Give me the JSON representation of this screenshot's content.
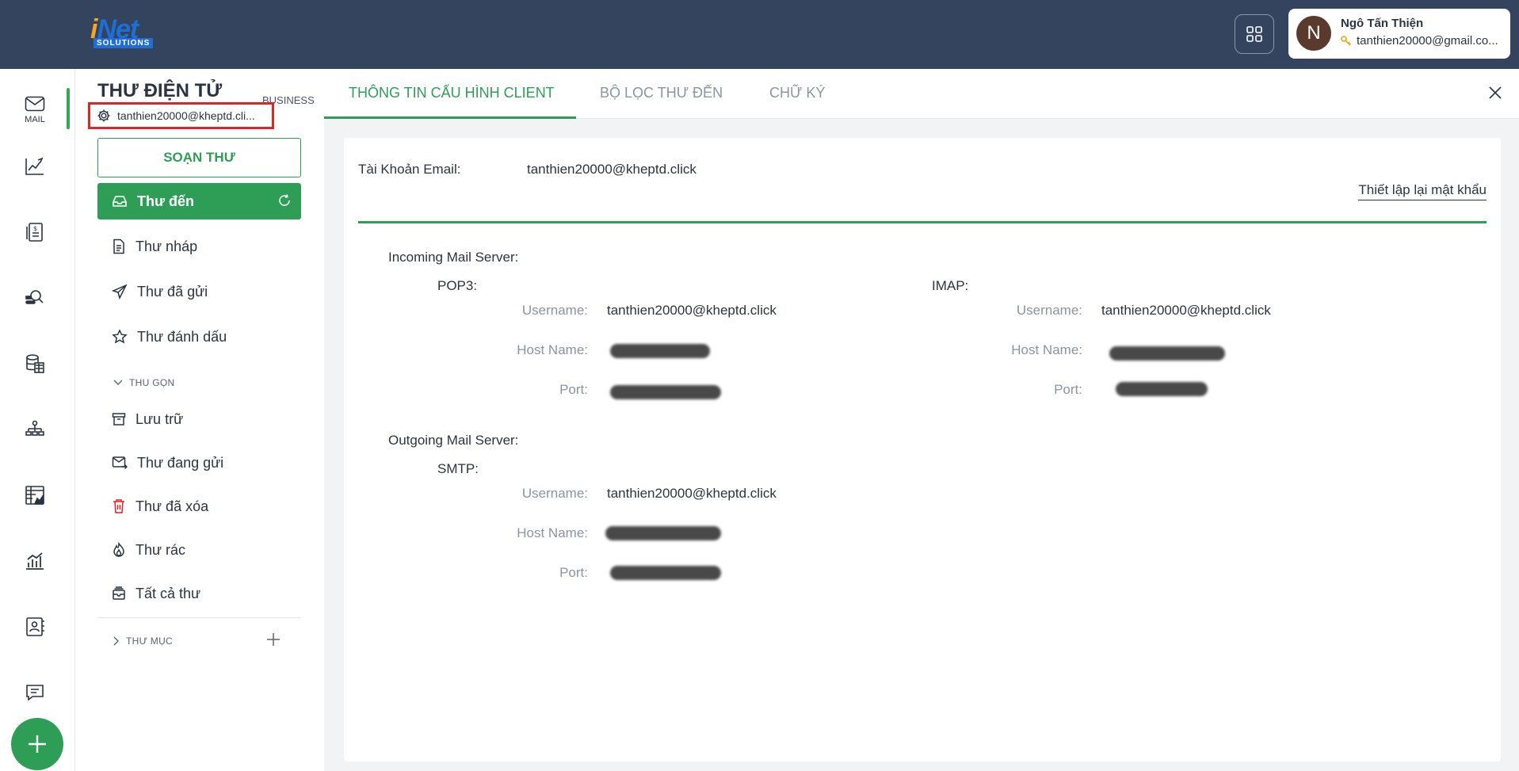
{
  "topbar": {
    "logo_main": "Net",
    "logo_i": "i",
    "logo_sub": "SOLUTIONS",
    "user_initial": "N",
    "user_name": "Ngô Tấn Thiện",
    "user_email": "tanthien20000@gmail.co..."
  },
  "rail": {
    "mail_label": "MAIL",
    "icons": [
      "mail-icon",
      "chart-pen-icon",
      "invoice-icon",
      "search-user-icon",
      "database-icon",
      "org-chart-icon",
      "spreadsheet-icon",
      "bar-chart-icon",
      "contact-card-icon",
      "chat-icon",
      "plus-icon"
    ]
  },
  "sidebar": {
    "title": "THƯ ĐIỆN TỬ",
    "badge": "BUSINESS",
    "account": "tanthien20000@kheptd.cli...",
    "compose": "SOẠN THƯ",
    "folders": [
      {
        "label": "Thư đến"
      },
      {
        "label": "Thư nháp"
      },
      {
        "label": "Thư đã gửi"
      },
      {
        "label": "Thư đánh dấu"
      }
    ],
    "collapse_label": "THU GỌN",
    "more_folders": [
      {
        "label": "Lưu trữ"
      },
      {
        "label": "Thư đang gửi"
      },
      {
        "label": "Thư đã xóa"
      },
      {
        "label": "Thư rác"
      },
      {
        "label": "Tất cả thư"
      }
    ],
    "directory_label": "THƯ MỤC"
  },
  "tabs": {
    "items": [
      {
        "label": "THÔNG TIN CẤU HÌNH CLIENT"
      },
      {
        "label": "BỘ LỌC THƯ ĐẾN"
      },
      {
        "label": "CHỮ KÝ"
      }
    ]
  },
  "config": {
    "account_label": "Tài Khoản Email:",
    "account_value": "tanthien20000@kheptd.click",
    "reset_link": "Thiết lập lại mật khẩu",
    "incoming_title": "Incoming Mail Server:",
    "outgoing_title": "Outgoing Mail Server:",
    "pop3": "POP3:",
    "imap": "IMAP:",
    "smtp": "SMTP:",
    "username_label": "Username:",
    "hostname_label": "Host Name:",
    "port_label": "Port:",
    "pop3_username": "tanthien20000@kheptd.click",
    "imap_username": "tanthien20000@kheptd.click",
    "smtp_username": "tanthien20000@kheptd.click"
  },
  "colors": {
    "accent": "#2e9e57",
    "topbar": "#34435e",
    "highlight_box": "#e02424"
  }
}
